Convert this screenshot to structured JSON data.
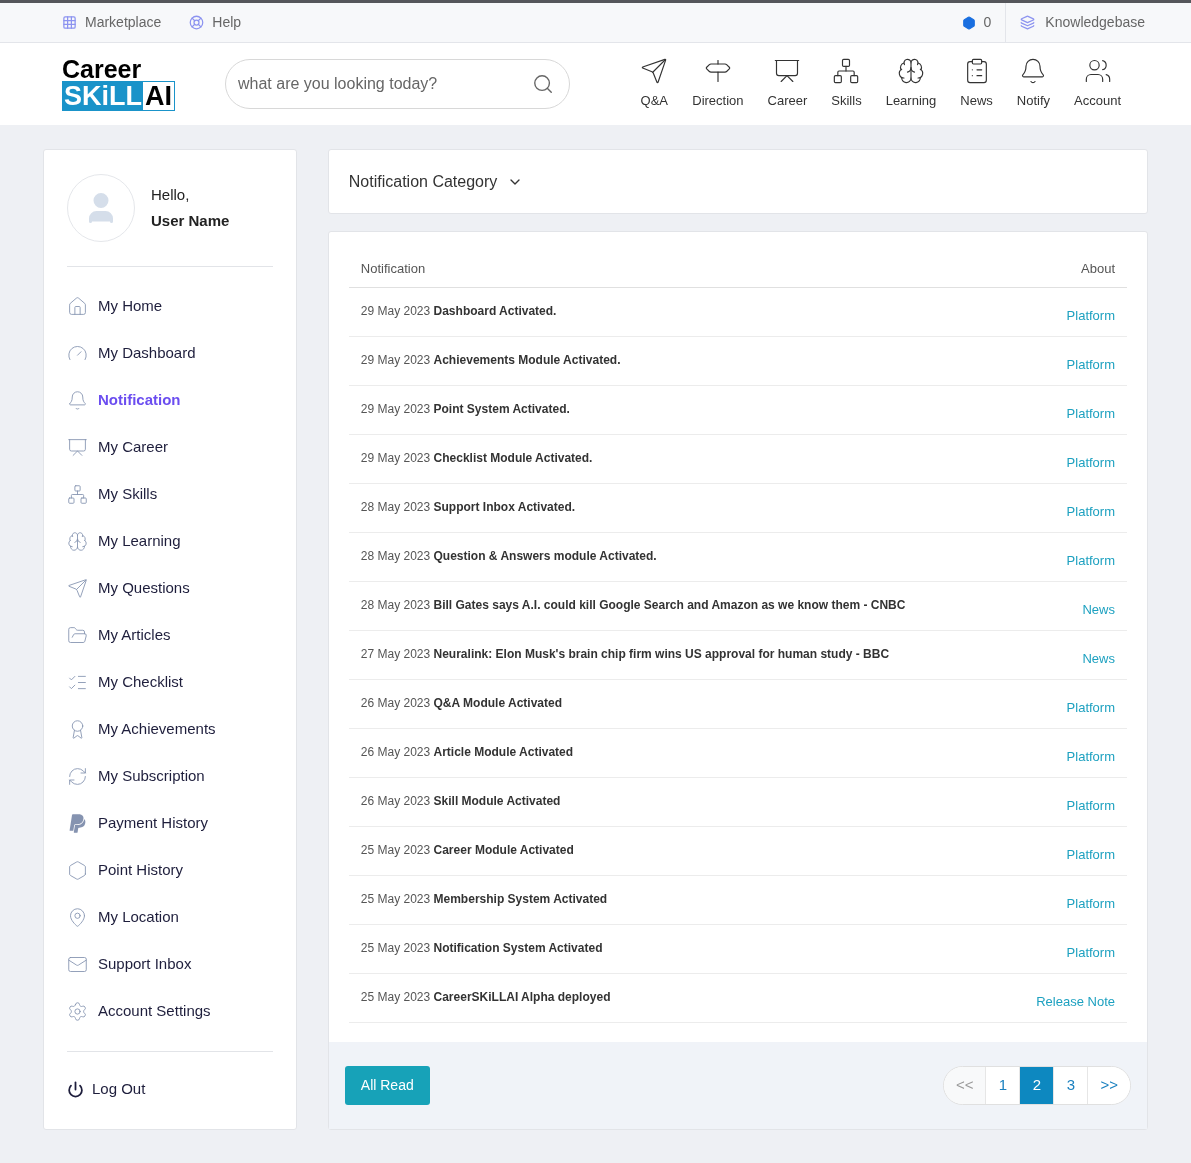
{
  "top_bar": {
    "links": [
      {
        "label": "Marketplace"
      },
      {
        "label": "Help"
      }
    ],
    "points": "0",
    "knowledgebase": "Knowledgebase"
  },
  "header": {
    "logo": {
      "line_1": "Career",
      "line_2": "SKiLL",
      "line_3": "AI"
    },
    "search": {
      "placeholder": "what are you looking today?"
    },
    "nav": [
      {
        "label": "Q&A"
      },
      {
        "label": "Direction"
      },
      {
        "label": "Career"
      },
      {
        "label": "Skills"
      },
      {
        "label": "Learning"
      },
      {
        "label": "News"
      },
      {
        "label": "Notify"
      },
      {
        "label": "Account"
      }
    ]
  },
  "sidebar": {
    "greeting": "Hello,",
    "user_name": "User Name",
    "items": [
      {
        "label": "My Home",
        "selected": false
      },
      {
        "label": "My Dashboard",
        "selected": false
      },
      {
        "label": "Notification",
        "selected": true
      },
      {
        "label": "My Career",
        "selected": false
      },
      {
        "label": "My Skills",
        "selected": false
      },
      {
        "label": "My Learning",
        "selected": false
      },
      {
        "label": "My Questions",
        "selected": false
      },
      {
        "label": "My Articles",
        "selected": false
      },
      {
        "label": "My Checklist",
        "selected": false
      },
      {
        "label": "My Achievements",
        "selected": false
      },
      {
        "label": "My Subscription",
        "selected": false
      },
      {
        "label": "Payment History",
        "selected": false
      },
      {
        "label": "Point History",
        "selected": false
      },
      {
        "label": "My Location",
        "selected": false
      },
      {
        "label": "Support Inbox",
        "selected": false
      },
      {
        "label": "Account Settings",
        "selected": false
      }
    ],
    "logout": "Log Out"
  },
  "category_dropdown": {
    "label": "Notification Category"
  },
  "table": {
    "columns": [
      "Notification",
      "About"
    ],
    "rows": [
      {
        "date": "29 May 2023",
        "title": "Dashboard Activated.",
        "about": "Platform"
      },
      {
        "date": "29 May 2023",
        "title": "Achievements Module Activated.",
        "about": "Platform"
      },
      {
        "date": "29 May 2023",
        "title": "Point System Activated.",
        "about": "Platform"
      },
      {
        "date": "29 May 2023",
        "title": "Checklist Module Activated.",
        "about": "Platform"
      },
      {
        "date": "28 May 2023",
        "title": "Support Inbox Activated.",
        "about": "Platform"
      },
      {
        "date": "28 May 2023",
        "title": "Question & Answers module Activated.",
        "about": "Platform"
      },
      {
        "date": "28 May 2023",
        "title": "Bill Gates says A.I. could kill Google Search and Amazon as we know them - CNBC",
        "about": "News"
      },
      {
        "date": "27 May 2023",
        "title": "Neuralink: Elon Musk's brain chip firm wins US approval for human study - BBC",
        "about": "News"
      },
      {
        "date": "26 May 2023",
        "title": "Q&A Module Activated",
        "about": "Platform"
      },
      {
        "date": "26 May 2023",
        "title": "Article Module Activated",
        "about": "Platform"
      },
      {
        "date": "26 May 2023",
        "title": "Skill Module Activated",
        "about": "Platform"
      },
      {
        "date": "25 May 2023",
        "title": "Career Module Activated",
        "about": "Platform"
      },
      {
        "date": "25 May 2023",
        "title": "Membership System Activated",
        "about": "Platform"
      },
      {
        "date": "25 May 2023",
        "title": "Notification System Activated",
        "about": "Platform"
      },
      {
        "date": "25 May 2023",
        "title": "CareerSKiLLAI Alpha deployed",
        "about": "Release Note"
      }
    ]
  },
  "footer": {
    "button": "All Read",
    "pagination": [
      {
        "label": "<<",
        "selected": false,
        "disabled": true
      },
      {
        "label": "1",
        "selected": false,
        "disabled": false
      },
      {
        "label": "2",
        "selected": true,
        "disabled": false
      },
      {
        "label": "3",
        "selected": false,
        "disabled": false
      },
      {
        "label": ">>",
        "selected": false,
        "disabled": false
      }
    ]
  }
}
